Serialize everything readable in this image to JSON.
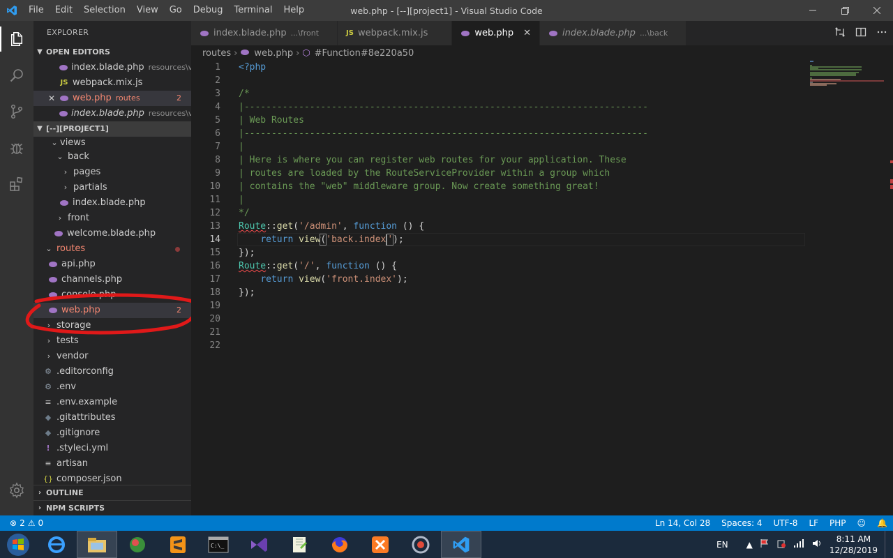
{
  "window": {
    "title": "web.php - [--][project1] - Visual Studio Code",
    "menu": [
      "File",
      "Edit",
      "Selection",
      "View",
      "Go",
      "Debug",
      "Terminal",
      "Help"
    ]
  },
  "sidebar": {
    "title": "EXPLORER",
    "open_editors_label": "OPEN EDITORS",
    "open_editors": [
      {
        "name": "index.blade.php",
        "desc": "resources\\vi...",
        "icon": "php-elephant-icon"
      },
      {
        "name": "webpack.mix.js",
        "desc": "",
        "icon": "js-icon"
      },
      {
        "name": "web.php",
        "desc": "routes",
        "badge": "2",
        "icon": "php-elephant-icon"
      },
      {
        "name": "index.blade.php",
        "desc": "resources\\vi...",
        "icon": "php-elephant-icon"
      }
    ],
    "project_label": "[--][PROJECT1]",
    "tree": [
      {
        "label": "views"
      },
      {
        "label": "back"
      },
      {
        "label": "pages"
      },
      {
        "label": "partials"
      },
      {
        "label": "index.blade.php"
      },
      {
        "label": "front"
      },
      {
        "label": "welcome.blade.php"
      },
      {
        "label": "routes"
      },
      {
        "label": "api.php"
      },
      {
        "label": "channels.php"
      },
      {
        "label": "console.php"
      },
      {
        "label": "web.php",
        "badge": "2"
      },
      {
        "label": "storage"
      },
      {
        "label": "tests"
      },
      {
        "label": "vendor"
      },
      {
        "label": ".editorconfig"
      },
      {
        "label": ".env"
      },
      {
        "label": ".env.example"
      },
      {
        "label": ".gitattributes"
      },
      {
        "label": ".gitignore"
      },
      {
        "label": ".styleci.yml"
      },
      {
        "label": "artisan"
      },
      {
        "label": "composer.json"
      }
    ],
    "outline_label": "OUTLINE",
    "npm_label": "NPM SCRIPTS"
  },
  "tabs": [
    {
      "label": "index.blade.php",
      "desc": "...\\front"
    },
    {
      "label": "webpack.mix.js",
      "desc": ""
    },
    {
      "label": "web.php",
      "desc": ""
    },
    {
      "label": "index.blade.php",
      "desc": "...\\back"
    }
  ],
  "breadcrumb": {
    "folder": "routes",
    "file": "web.php",
    "symbol": "#Function#8e220a50"
  },
  "editor": {
    "line_numbers": [
      "1",
      "2",
      "3",
      "4",
      "5",
      "6",
      "7",
      "8",
      "9",
      "10",
      "11",
      "12",
      "13",
      "14",
      "15",
      "16",
      "17",
      "18",
      "19",
      "20",
      "21",
      "22"
    ],
    "lines": {
      "l1": "<?php",
      "l3": "/*",
      "l4": "|--------------------------------------------------------------------------",
      "l5": "| Web Routes",
      "l6": "|--------------------------------------------------------------------------",
      "l7": "|",
      "l8": "| Here is where you can register web routes for your application. These",
      "l9": "| routes are loaded by the RouteServiceProvider within a group which",
      "l10": "| contains the \"web\" middleware group. Now create something great!",
      "l11": "|",
      "l12": "*/",
      "route": "Route",
      "dcolon": "::",
      "get": "get",
      "paren_open": "(",
      "admin_str": "'/admin'",
      "comma": ", ",
      "function_kw": "function",
      "fn_tail": " () {",
      "indent": "    ",
      "return_kw": "return",
      "view_fn": " view",
      "back_str_a": "'back.index",
      "back_str_b": "'",
      "close_stmt": ");",
      "close_block": "});",
      "root_str": "'/'",
      "front_str": "'front.index'"
    }
  },
  "status": {
    "errors": "2",
    "warnings": "0",
    "position": "Ln 14, Col 28",
    "spaces": "Spaces: 4",
    "encoding": "UTF-8",
    "eol": "LF",
    "language": "PHP"
  },
  "taskbar": {
    "lang": "EN",
    "time": "8:11 AM",
    "date": "12/28/2019"
  }
}
